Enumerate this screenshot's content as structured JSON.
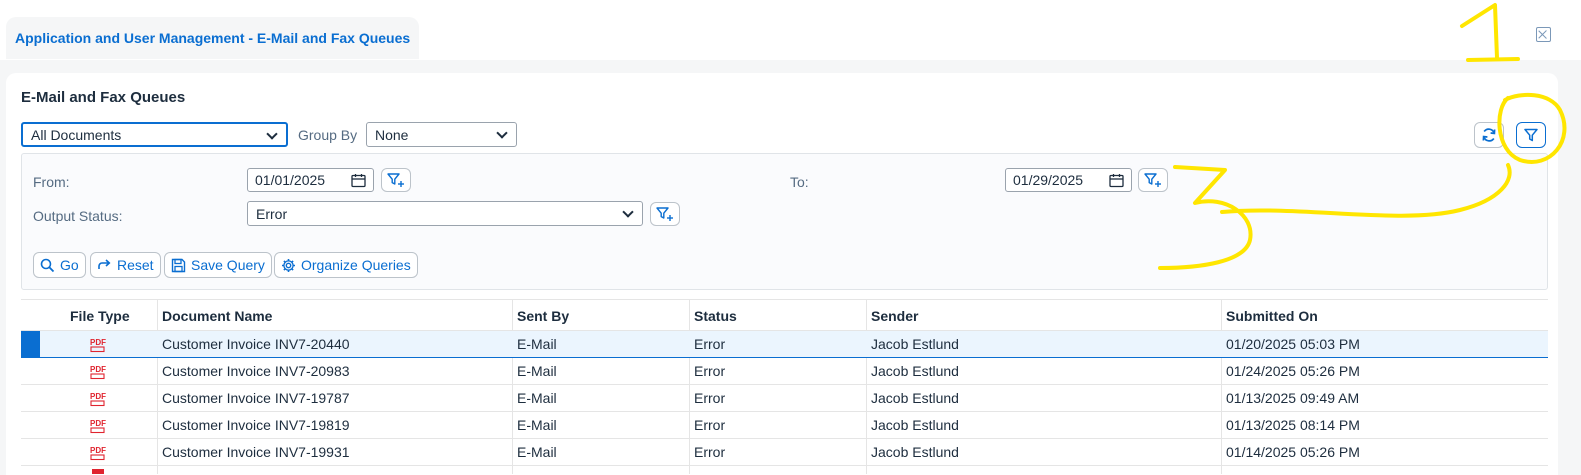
{
  "shell": {
    "tab_title": "Application and User Management - E-Mail and Fax Queues"
  },
  "page": {
    "title": "E-Mail and Fax Queues",
    "view_select": "All Documents",
    "group_by_label": "Group By",
    "group_by_value": "None"
  },
  "filters": {
    "from_label": "From:",
    "from_value": "01/01/2025",
    "to_label": "To:",
    "to_value": "01/29/2025",
    "output_status_label": "Output Status:",
    "output_status_value": "Error",
    "actions": {
      "go": "Go",
      "reset": "Reset",
      "save_query": "Save Query",
      "organize_queries": "Organize Queries"
    }
  },
  "table": {
    "columns": [
      "File Type",
      "Document Name",
      "Sent By",
      "Status",
      "Sender",
      "Submitted On"
    ],
    "rows": [
      {
        "file_type": "PDF",
        "document_name": "Customer Invoice INV7-20440",
        "sent_by": "E-Mail",
        "status": "Error",
        "sender": "Jacob Estlund",
        "submitted_on": "01/20/2025 05:03 PM"
      },
      {
        "file_type": "PDF",
        "document_name": "Customer Invoice INV7-20983",
        "sent_by": "E-Mail",
        "status": "Error",
        "sender": "Jacob Estlund",
        "submitted_on": "01/24/2025 05:26 PM"
      },
      {
        "file_type": "PDF",
        "document_name": "Customer Invoice INV7-19787",
        "sent_by": "E-Mail",
        "status": "Error",
        "sender": "Jacob Estlund",
        "submitted_on": "01/13/2025 09:49 AM"
      },
      {
        "file_type": "PDF",
        "document_name": "Customer Invoice INV7-19819",
        "sent_by": "E-Mail",
        "status": "Error",
        "sender": "Jacob Estlund",
        "submitted_on": "01/13/2025 08:14 PM"
      },
      {
        "file_type": "PDF",
        "document_name": "Customer Invoice INV7-19931",
        "sent_by": "E-Mail",
        "status": "Error",
        "sender": "Jacob Estlund",
        "submitted_on": "01/14/2025 05:26 PM"
      }
    ]
  },
  "annotations": {
    "step_1": "1",
    "step_3": "3"
  },
  "colors": {
    "accent": "#0a6ed1",
    "selected_row": "#ebf5fe",
    "annotation": "#ffe600",
    "pdf_icon": "#e0242f"
  }
}
